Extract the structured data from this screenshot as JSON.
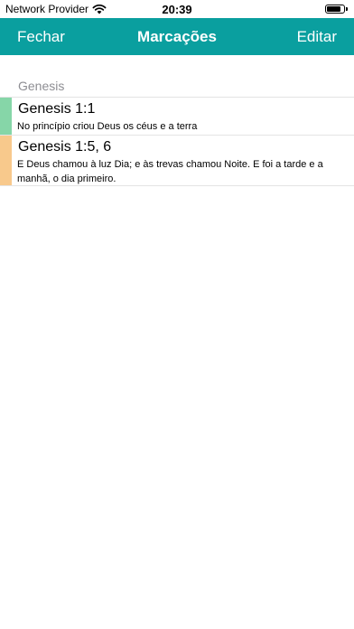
{
  "status_bar": {
    "carrier": "Network Provider",
    "time": "20:39",
    "wifi_icon": "wifi-icon",
    "battery_icon": "battery-icon",
    "battery_level": 0.9
  },
  "nav": {
    "left_label": "Fechar",
    "title": "Marcações",
    "right_label": "Editar",
    "background": "#0a9f9f"
  },
  "section": {
    "title": "Genesis"
  },
  "bookmarks": [
    {
      "reference": "Genesis 1:1",
      "text": "No princípio criou Deus os céus e a terra",
      "color": "#86d6a8"
    },
    {
      "reference": "Genesis 1:5, 6",
      "text": "E Deus chamou à luz Dia; e às trevas chamou Noite. E foi a tarde e a manhã, o dia primeiro.",
      "color": "#f8c98c"
    }
  ]
}
